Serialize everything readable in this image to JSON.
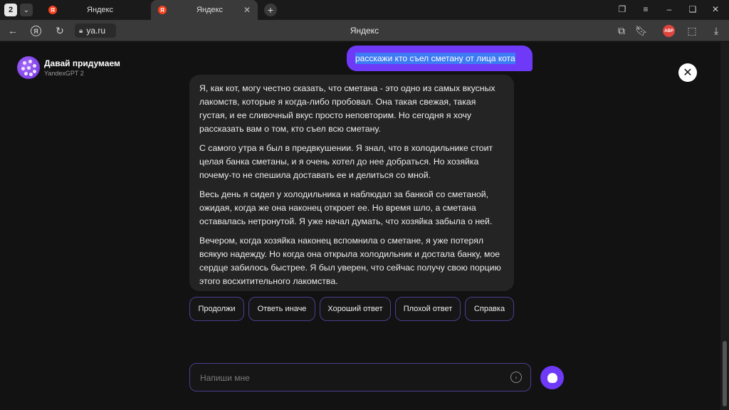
{
  "browser": {
    "tab_count": "2",
    "tabs": [
      {
        "favicon": "Я",
        "title": "Яндекс"
      },
      {
        "favicon": "Я",
        "title": "Яндекс"
      }
    ],
    "url": "ya.ru",
    "page_title": "Яндекс",
    "abp_label": "ABP"
  },
  "chat": {
    "bot_title": "Давай придумаем",
    "bot_subtitle": "YandexGPT 2",
    "user_message": "расскажи кто съел сметану от лица кота",
    "bot_paragraphs": [
      "Я, как кот, могу честно сказать, что сметана - это одно из самых вкусных лакомств, которые я когда-либо пробовал. Она такая свежая, такая густая, и ее сливочный вкус просто неповторим. Но сегодня я хочу рассказать вам о том, кто съел всю сметану.",
      "С самого утра я был в предвкушении. Я знал, что в холодильнике стоит целая банка сметаны, и я очень хотел до нее добраться. Но хозяйка почему-то не спешила доставать ее и делиться со мной.",
      "Весь день я сидел у холодильника и наблюдал за банкой со сметаной, ожидая, когда же она наконец откроет ее. Но время шло, а сметана оставалась нетронутой. Я уже начал думать, что хозяйка забыла о ней.",
      "Вечером, когда хозяйка наконец вспомнила о сметане, я уже потерял всякую надежду. Но когда она открыла холодильник и достала банку, мое сердце забилось быстрее. Я был уверен, что сейчас получу свою порцию этого восхитительного лакомства."
    ],
    "suggestions": [
      "Продолжи",
      "Ответь иначе",
      "Хороший ответ",
      "Плохой ответ",
      "Справка"
    ],
    "input_placeholder": "Напиши мне"
  },
  "colors": {
    "accent": "#6f3af7",
    "background": "#121212",
    "bubble": "#242424"
  }
}
